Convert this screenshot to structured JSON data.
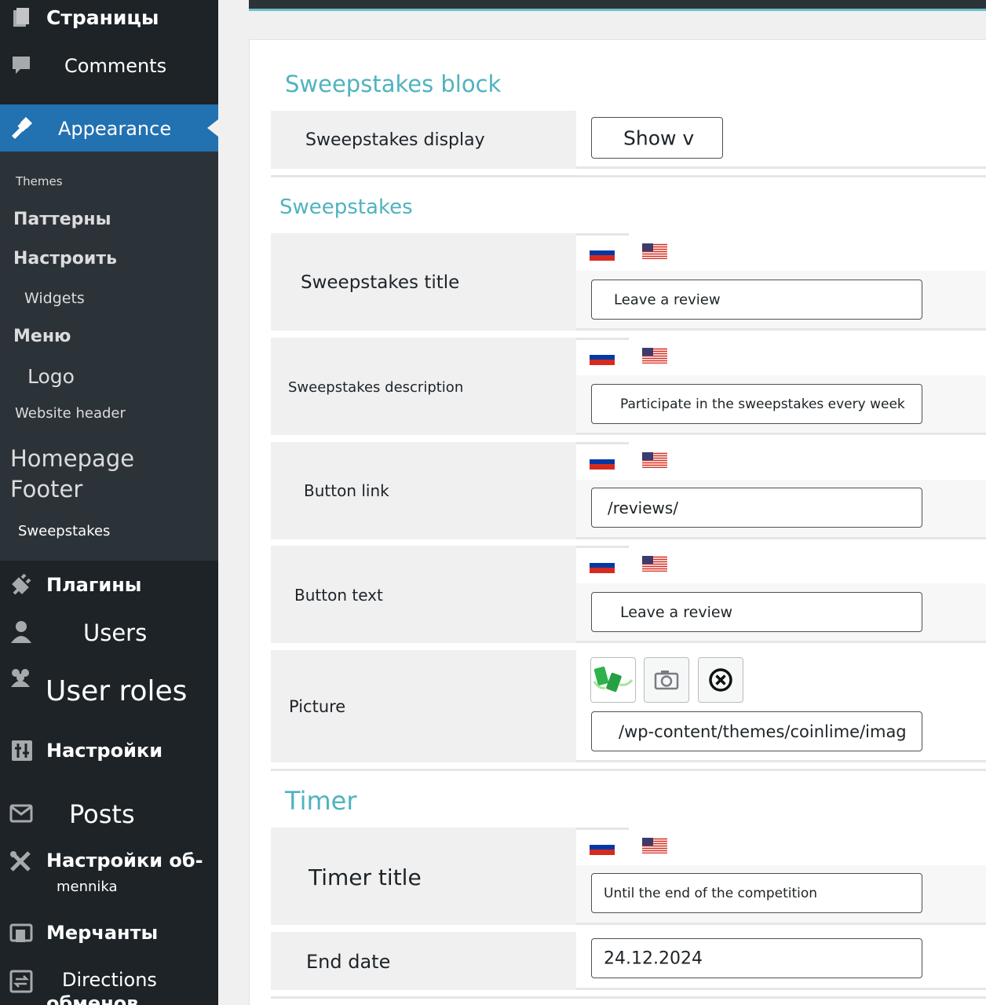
{
  "sidebar": {
    "pages": "Страницы",
    "comments": "Comments",
    "appearance": "Appearance",
    "submenu": {
      "themes": "Themes",
      "patterns": "Паттерны",
      "customize": "Настроить",
      "widgets": "Widgets",
      "menus": "Меню",
      "logo": "Logo",
      "website_header": "Website header",
      "homepage_line1": "Homepage",
      "homepage_line2": "Footer",
      "sweepstakes": "Sweepstakes"
    },
    "plugins": "Плагины",
    "users": "Users",
    "user_roles": "User roles",
    "settings": "Настройки",
    "posts": "Posts",
    "exchange_settings_line1": "Настройки об-",
    "exchange_settings_line2": "mennika",
    "merchants": "Мерчанты",
    "directions_line1": "Directions",
    "directions_line2": "обменов"
  },
  "sections": {
    "sweepstakes_block": {
      "title": "Sweepstakes block",
      "display_label": "Sweepstakes display",
      "display_value": "Show v"
    },
    "sweepstakes": {
      "title": "Sweepstakes",
      "fields": {
        "title_label": "Sweepstakes title",
        "title_value": "Leave a review",
        "description_label": "Sweepstakes description",
        "description_value": "Participate in the sweepstakes every week",
        "button_link_label": "Button link",
        "button_link_value": "/reviews/",
        "button_text_label": "Button text",
        "button_text_value": "Leave a review",
        "picture_label": "Picture",
        "picture_value": "/wp-content/themes/coinlime/imag"
      }
    },
    "timer": {
      "title": "Timer",
      "timer_title_label": "Timer title",
      "timer_title_value": "Until the end of the competition",
      "end_date_label": "End date",
      "end_date_value": "24.12.2024"
    }
  },
  "icons": {
    "flag_ru": "flag-russia-icon",
    "flag_us": "flag-usa-icon",
    "camera": "camera-icon",
    "remove": "close-circle-icon"
  },
  "colors": {
    "accent": "#4fb3bf",
    "sidebar_bg": "#1d2327",
    "active": "#2271b1"
  }
}
